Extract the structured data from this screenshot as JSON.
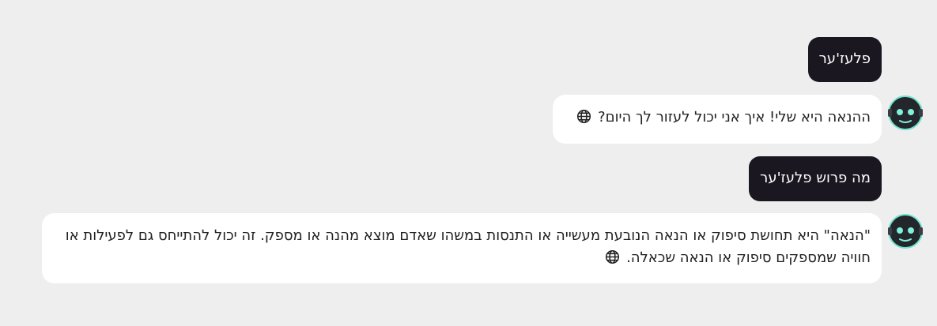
{
  "conversation": {
    "messages": [
      {
        "role": "user",
        "text": "פלעז'ער"
      },
      {
        "role": "assistant",
        "text": "ההנאה היא שלי! איך אני יכול לעזור לך היום?",
        "icon": "globe-icon"
      },
      {
        "role": "user",
        "text": "מה פרוש פלעז'ער"
      },
      {
        "role": "assistant",
        "text": "\"הנאה\" היא תחושת סיפוק או הנאה הנובעת מעשייה או התנסות במשהו שאדם מוצא מהנה או מספק. זה יכול להתייחס גם לפעילות או חוויה שמספקים סיפוק או הנאה שכאלה.",
        "icon": "globe-icon"
      }
    ]
  },
  "colors": {
    "background": "#eeeeee",
    "user_bubble": "#1b1720",
    "assistant_bubble": "#ffffff",
    "avatar_glow": "#6fe3cf"
  }
}
